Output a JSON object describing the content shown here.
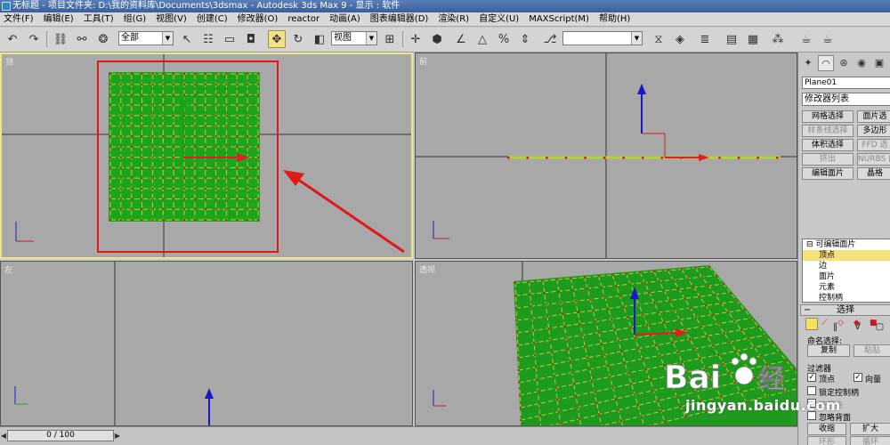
{
  "window": {
    "title": "无标题 - 项目文件夹: D:\\我的资料库\\Documents\\3dsmax - Autodesk 3ds Max 9 - 显示 : 软件"
  },
  "menu": [
    "文件(F)",
    "编辑(E)",
    "工具(T)",
    "组(G)",
    "视图(V)",
    "创建(C)",
    "修改器(O)",
    "reactor",
    "动画(A)",
    "图表编辑器(D)",
    "渲染(R)",
    "自定义(U)",
    "MAXScript(M)",
    "帮助(H)"
  ],
  "toolbar": {
    "selection_filter": "全部",
    "ref_coord": "视图",
    "named_selection": "",
    "icons": [
      "undo-icon",
      "redo-icon",
      "link-icon",
      "unlink-icon",
      "bind-spacewarp-icon",
      "select-icon",
      "select-by-name-icon",
      "rect-select-icon",
      "window-crossing-icon",
      "move-icon",
      "rotate-icon",
      "scale-icon",
      "pivot-icon",
      "select-manipulate-icon",
      "snap-3d-icon",
      "angle-snap-icon",
      "percent-snap-icon",
      "spinner-snap-icon",
      "edit-named-sel-icon",
      "mirror-icon",
      "align-icon",
      "layer-manager-icon",
      "curve-editor-icon",
      "schematic-view-icon",
      "material-editor-icon",
      "render-scene-icon",
      "quick-render-icon"
    ]
  },
  "viewports": {
    "top": {
      "label": "顶"
    },
    "front": {
      "label": "前"
    },
    "left": {
      "label": "左"
    },
    "perspective": {
      "label": "透视"
    }
  },
  "command_panel": {
    "object_name": "Plane01",
    "modifier_list": "修改器列表",
    "buttons": [
      {
        "label": "网格选择",
        "enabled": true
      },
      {
        "label": "面片选",
        "enabled": true
      },
      {
        "label": "样条线选择",
        "enabled": false
      },
      {
        "label": "多边形",
        "enabled": true
      },
      {
        "label": "体积选择",
        "enabled": true
      },
      {
        "label": "FFD 选",
        "enabled": false
      },
      {
        "label": "挤出",
        "enabled": false
      },
      {
        "label": "NURBS 曲",
        "enabled": false
      },
      {
        "label": "编辑面片",
        "enabled": true
      },
      {
        "label": "晶格",
        "enabled": true
      }
    ],
    "stack": [
      {
        "label": "可编辑面片",
        "level": 0,
        "selected": false,
        "prefix": "⊟"
      },
      {
        "label": "顶点",
        "level": 1,
        "selected": true
      },
      {
        "label": "边",
        "level": 1,
        "selected": false
      },
      {
        "label": "面片",
        "level": 1,
        "selected": false
      },
      {
        "label": "元素",
        "level": 1,
        "selected": false
      },
      {
        "label": "控制柄",
        "level": 1,
        "selected": false
      }
    ],
    "selection_rollout": {
      "title": "选择",
      "named_selections": "命名选择:",
      "copy": "复制",
      "paste": "粘贴",
      "filter": "过滤器",
      "vertex_check": "顶点",
      "vector_check": "向量",
      "lock_handles": "锁定控制柄",
      "by_vertex": "按顶点",
      "ignore_backfacing": "忽略背面",
      "shrink": "收缩",
      "grow": "扩大",
      "ring": "环形",
      "loop": "循环"
    }
  },
  "status": {
    "time_slider": "0 / 100"
  },
  "watermark": {
    "text": "jingyan.baidu.com"
  }
}
